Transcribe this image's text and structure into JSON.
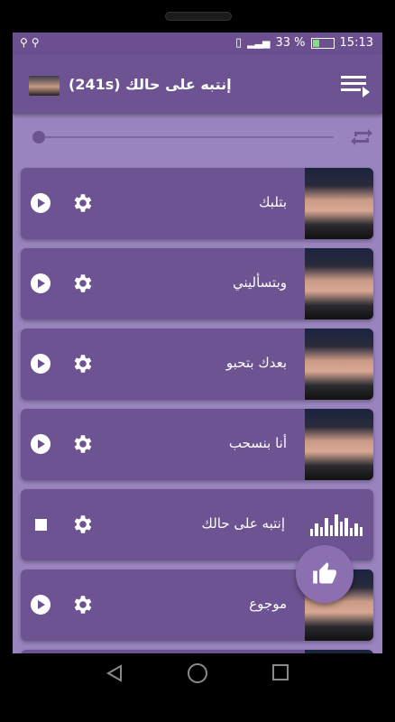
{
  "statusbar": {
    "left_icons": "⚲ ⚲",
    "signal_text": "📳  ",
    "battery_percent": "33 %",
    "battery_level": 0.33,
    "time": "15:13"
  },
  "header": {
    "title": "إنتبه على حالك (241s)",
    "playlist_icon": "playlist-icon"
  },
  "player": {
    "progress": 0.0,
    "repeat_icon": "repeat-icon"
  },
  "songs": [
    {
      "title": "بتلبك",
      "state": "paused"
    },
    {
      "title": "وبتسأليني",
      "state": "paused"
    },
    {
      "title": "بعدك بتحبو",
      "state": "paused"
    },
    {
      "title": "أنا بنسحب",
      "state": "paused"
    },
    {
      "title": "إنتبه على حالك",
      "state": "playing"
    },
    {
      "title": "موجوع",
      "state": "paused"
    }
  ],
  "colors": {
    "background": "#9a84bf",
    "card": "#6e5392",
    "statusbar": "#6b4f8f",
    "fab": "#8c6fb0"
  },
  "fab": {
    "icon": "thumbs-up-icon"
  }
}
